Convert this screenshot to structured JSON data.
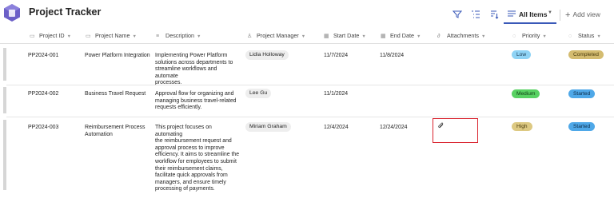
{
  "header": {
    "title": "Project Tracker",
    "star": "☆",
    "active_view": "All Items",
    "add_view": "Add view",
    "colors": {
      "logo": "#6b5fc7",
      "tab_underline": "#3a59b8"
    }
  },
  "columns": [
    {
      "icon": "id-icon",
      "label": "Project ID"
    },
    {
      "icon": "text-icon",
      "label": "Project Name"
    },
    {
      "icon": "multiline-text-icon",
      "label": "Description"
    },
    {
      "icon": "person-icon",
      "label": "Project Manager"
    },
    {
      "icon": "calendar-icon",
      "label": "Start Date"
    },
    {
      "icon": "calendar-icon",
      "label": "End Date"
    },
    {
      "icon": "paperclip-icon",
      "label": "Attachments"
    },
    {
      "icon": "choice-icon",
      "label": "Priority"
    },
    {
      "icon": "choice-icon",
      "label": "Status"
    }
  ],
  "rows": [
    {
      "id": "PP2024-001",
      "name": [
        "Power Platform Integration"
      ],
      "description": [
        "Implementing Power Platform",
        "solutions across departments to",
        "streamline workflows and automate",
        "processes."
      ],
      "manager": "Lidia Holloway",
      "start": "11/7/2024",
      "end": "11/8/2024",
      "priority": "Low",
      "status": "Completed"
    },
    {
      "id": "PP2024-002",
      "name": [
        "Business Travel Request"
      ],
      "description": [
        "Approval flow for organizing and",
        "managing business travel-related",
        "requests efficiently."
      ],
      "manager": "Lee Gu",
      "start": "11/1/2024",
      "end": "",
      "priority": "Medium",
      "status": "Started"
    },
    {
      "id": "PP2024-003",
      "name": [
        "Reimbursement Process",
        "Automation"
      ],
      "description": [
        "This project focuses on automating",
        "the reimbursement request and",
        "approval process to improve",
        "efficiency. It aims to streamline the",
        "workflow for employees to submit",
        "their reimbursement claims,",
        "facilitate quick approvals from",
        "managers, and ensure timely",
        "processing of payments."
      ],
      "manager": "Miriam Graham",
      "start": "12/4/2024",
      "end": "12/24/2024",
      "attachment_icon": "paperclip-icon",
      "priority": "High",
      "status": "Started"
    }
  ],
  "pill_colors": {
    "Low": {
      "bg": "#8fd3f5",
      "fg": "#1b3a52"
    },
    "Medium": {
      "bg": "#58d162",
      "fg": "#0e3d14"
    },
    "High": {
      "bg": "#ddc982",
      "fg": "#4a3b0c"
    },
    "Completed": {
      "bg": "#d4bc70",
      "fg": "#4a3b0c"
    },
    "Started": {
      "bg": "#4fa8e8",
      "fg": "#0d2b47"
    }
  },
  "highlight_color": "#d9232e"
}
